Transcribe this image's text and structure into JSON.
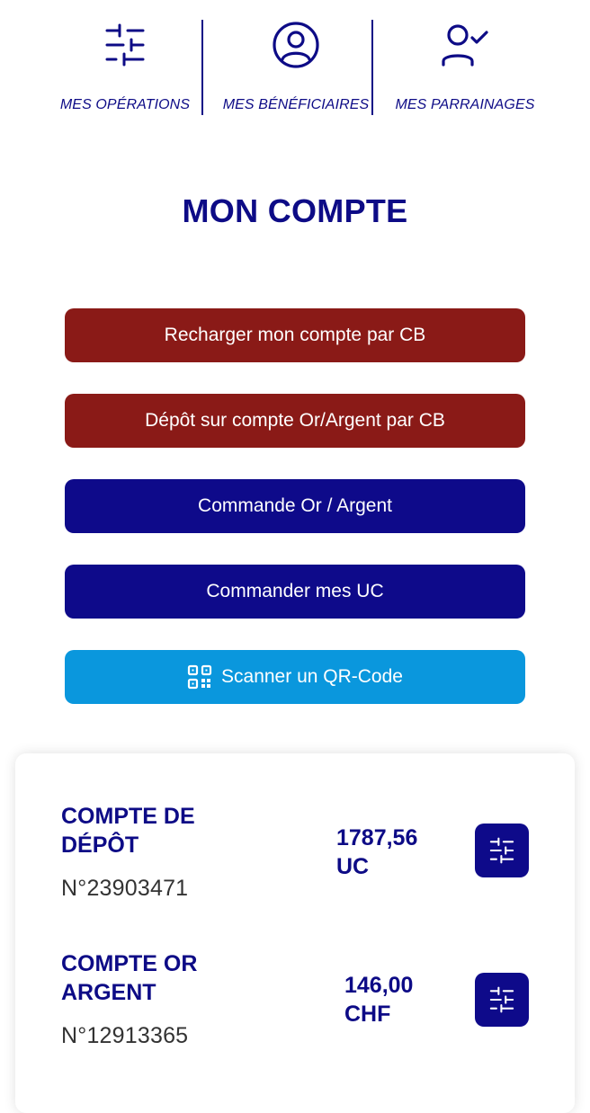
{
  "nav": {
    "items": [
      {
        "label": "MES OPÉRATIONS",
        "icon": "sliders-icon"
      },
      {
        "label": "MES BÉNÉFICIAIRES",
        "icon": "user-circle-icon"
      },
      {
        "label": "MES PARRAINAGES",
        "icon": "user-check-icon"
      }
    ]
  },
  "page": {
    "title": "MON COMPTE"
  },
  "actions": {
    "recharge_label": "Recharger mon compte par CB",
    "deposit_label": "Dépôt sur compte Or/Argent par CB",
    "order_gold_label": "Commande Or / Argent",
    "order_uc_label": "Commander mes UC",
    "scan_label": "Scanner un QR-Code"
  },
  "accounts": [
    {
      "name": "COMPTE DE DÉPÔT",
      "number": "N°23903471",
      "amount": "1787,56",
      "currency": "UC"
    },
    {
      "name": "COMPTE OR ARGENT",
      "number": "N°12913365",
      "amount": "146,00",
      "currency": "CHF"
    }
  ],
  "colors": {
    "brand_navy": "#0e0a8a",
    "brand_red": "#8a1a17",
    "brand_light_blue": "#0a97dd"
  }
}
